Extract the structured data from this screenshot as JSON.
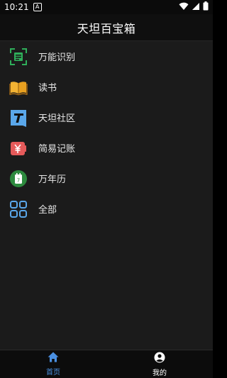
{
  "status_bar": {
    "time": "10:21",
    "notification_glyph": "A",
    "icons": [
      "wifi-icon",
      "signal-icon",
      "battery-icon"
    ]
  },
  "header": {
    "title": "天坦百宝箱"
  },
  "menu": {
    "items": [
      {
        "label": "万能识别",
        "icon": "scan-icon",
        "color": "#2fae5a"
      },
      {
        "label": "读书",
        "icon": "book-icon",
        "color": "#f2b233"
      },
      {
        "label": "天坦社区",
        "icon": "community-t-icon",
        "color": "#5aa7ea"
      },
      {
        "label": "简易记账",
        "icon": "ledger-yen-icon",
        "color": "#e55a5a"
      },
      {
        "label": "万年历",
        "icon": "calendar-icon",
        "color": "#2d8a3e"
      },
      {
        "label": "全部",
        "icon": "grid-all-icon",
        "color": "#5aa7ea"
      }
    ]
  },
  "bottom_nav": {
    "items": [
      {
        "label": "首页",
        "icon": "home-icon",
        "active": true,
        "color": "#4a90e2"
      },
      {
        "label": "我的",
        "icon": "profile-icon",
        "active": false,
        "color": "#ffffff"
      }
    ]
  },
  "colors": {
    "background": "#1b1b1b",
    "header_bg": "#0f0f0f",
    "status_bg": "#0b0b0b",
    "nav_bg": "#0c0c0c",
    "accent": "#4a90e2"
  }
}
